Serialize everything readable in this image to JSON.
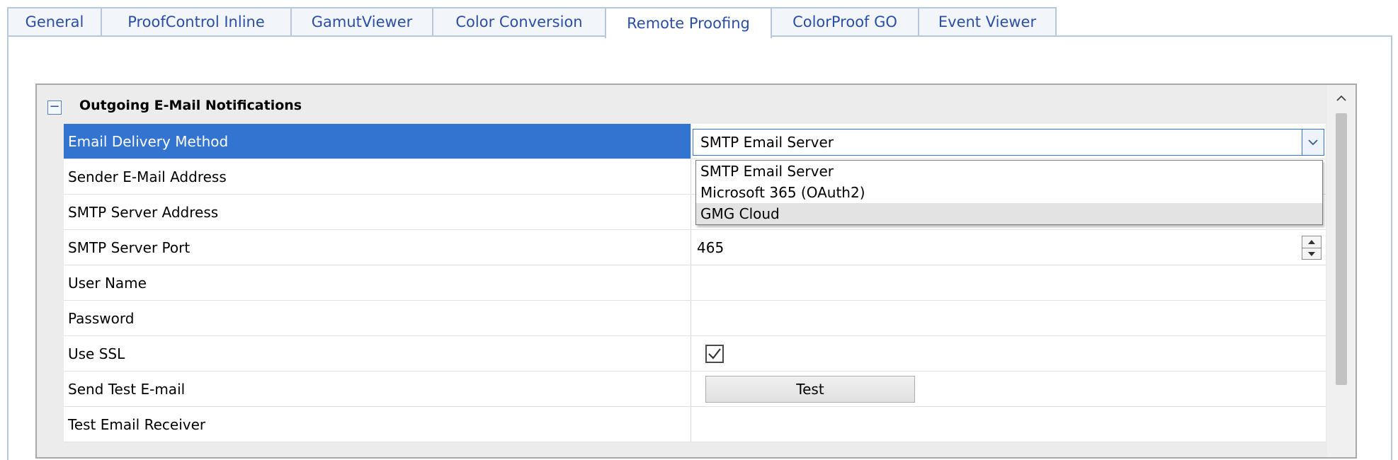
{
  "tabs": [
    {
      "label": "General"
    },
    {
      "label": "ProofControl Inline"
    },
    {
      "label": "GamutViewer"
    },
    {
      "label": "Color Conversion"
    },
    {
      "label": "Remote Proofing"
    },
    {
      "label": "ColorProof GO"
    },
    {
      "label": "Event Viewer"
    }
  ],
  "active_tab": "Remote Proofing",
  "group": {
    "collapse_symbol": "−",
    "title": "Outgoing E-Mail Notifications"
  },
  "rows": {
    "delivery_method": {
      "label": "Email Delivery Method",
      "value": "SMTP Email Server"
    },
    "sender": {
      "label": "Sender E-Mail Address"
    },
    "smtp_address": {
      "label": "SMTP Server Address"
    },
    "smtp_port": {
      "label": "SMTP Server Port",
      "value": "465"
    },
    "user_name": {
      "label": "User Name"
    },
    "password": {
      "label": "Password"
    },
    "use_ssl": {
      "label": "Use SSL",
      "checked": true
    },
    "send_test": {
      "label": "Send Test E-mail",
      "button": "Test"
    },
    "test_receiver": {
      "label": "Test Email Receiver"
    }
  },
  "dropdown": {
    "options": [
      "SMTP Email Server",
      "Microsoft 365 (OAuth2)",
      "GMG Cloud"
    ],
    "hovered": "GMG Cloud"
  },
  "colors": {
    "selection": "#3374d1",
    "tab_text": "#2a4fa8",
    "tab_border": "#b7c8de"
  }
}
